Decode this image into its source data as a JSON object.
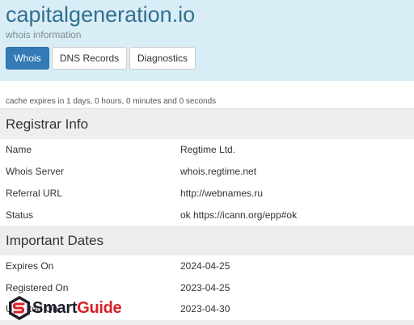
{
  "header": {
    "title": "capitalgeneration.io",
    "subtitle": "whois information"
  },
  "tabs": [
    {
      "label": "Whois",
      "active": true
    },
    {
      "label": "DNS Records",
      "active": false
    },
    {
      "label": "Diagnostics",
      "active": false
    }
  ],
  "cache_note": "cache expires in 1 days, 0 hours, 0 minutes and 0 seconds",
  "registrar": {
    "heading": "Registrar Info",
    "rows": [
      {
        "label": "Name",
        "value": "Regtime Ltd."
      },
      {
        "label": "Whois Server",
        "value": "whois.regtime.net"
      },
      {
        "label": "Referral URL",
        "value": "http://webnames.ru"
      },
      {
        "label": "Status",
        "value": "ok https://icann.org/epp#ok"
      }
    ]
  },
  "dates": {
    "heading": "Important Dates",
    "rows": [
      {
        "label": "Expires On",
        "value": "2024-04-25"
      },
      {
        "label": "Registered On",
        "value": "2023-04-25"
      },
      {
        "label": "Updated On",
        "value": "2023-04-30"
      }
    ]
  },
  "watermark": {
    "part1": "Smart",
    "part2": "Guide",
    "colors": {
      "dark": "#1c1c2b",
      "red": "#d82027"
    }
  },
  "colors": {
    "header_bg": "#d9edf7",
    "title": "#31708f",
    "active_tab": "#337ab7",
    "section_bg": "#eeeeee"
  }
}
